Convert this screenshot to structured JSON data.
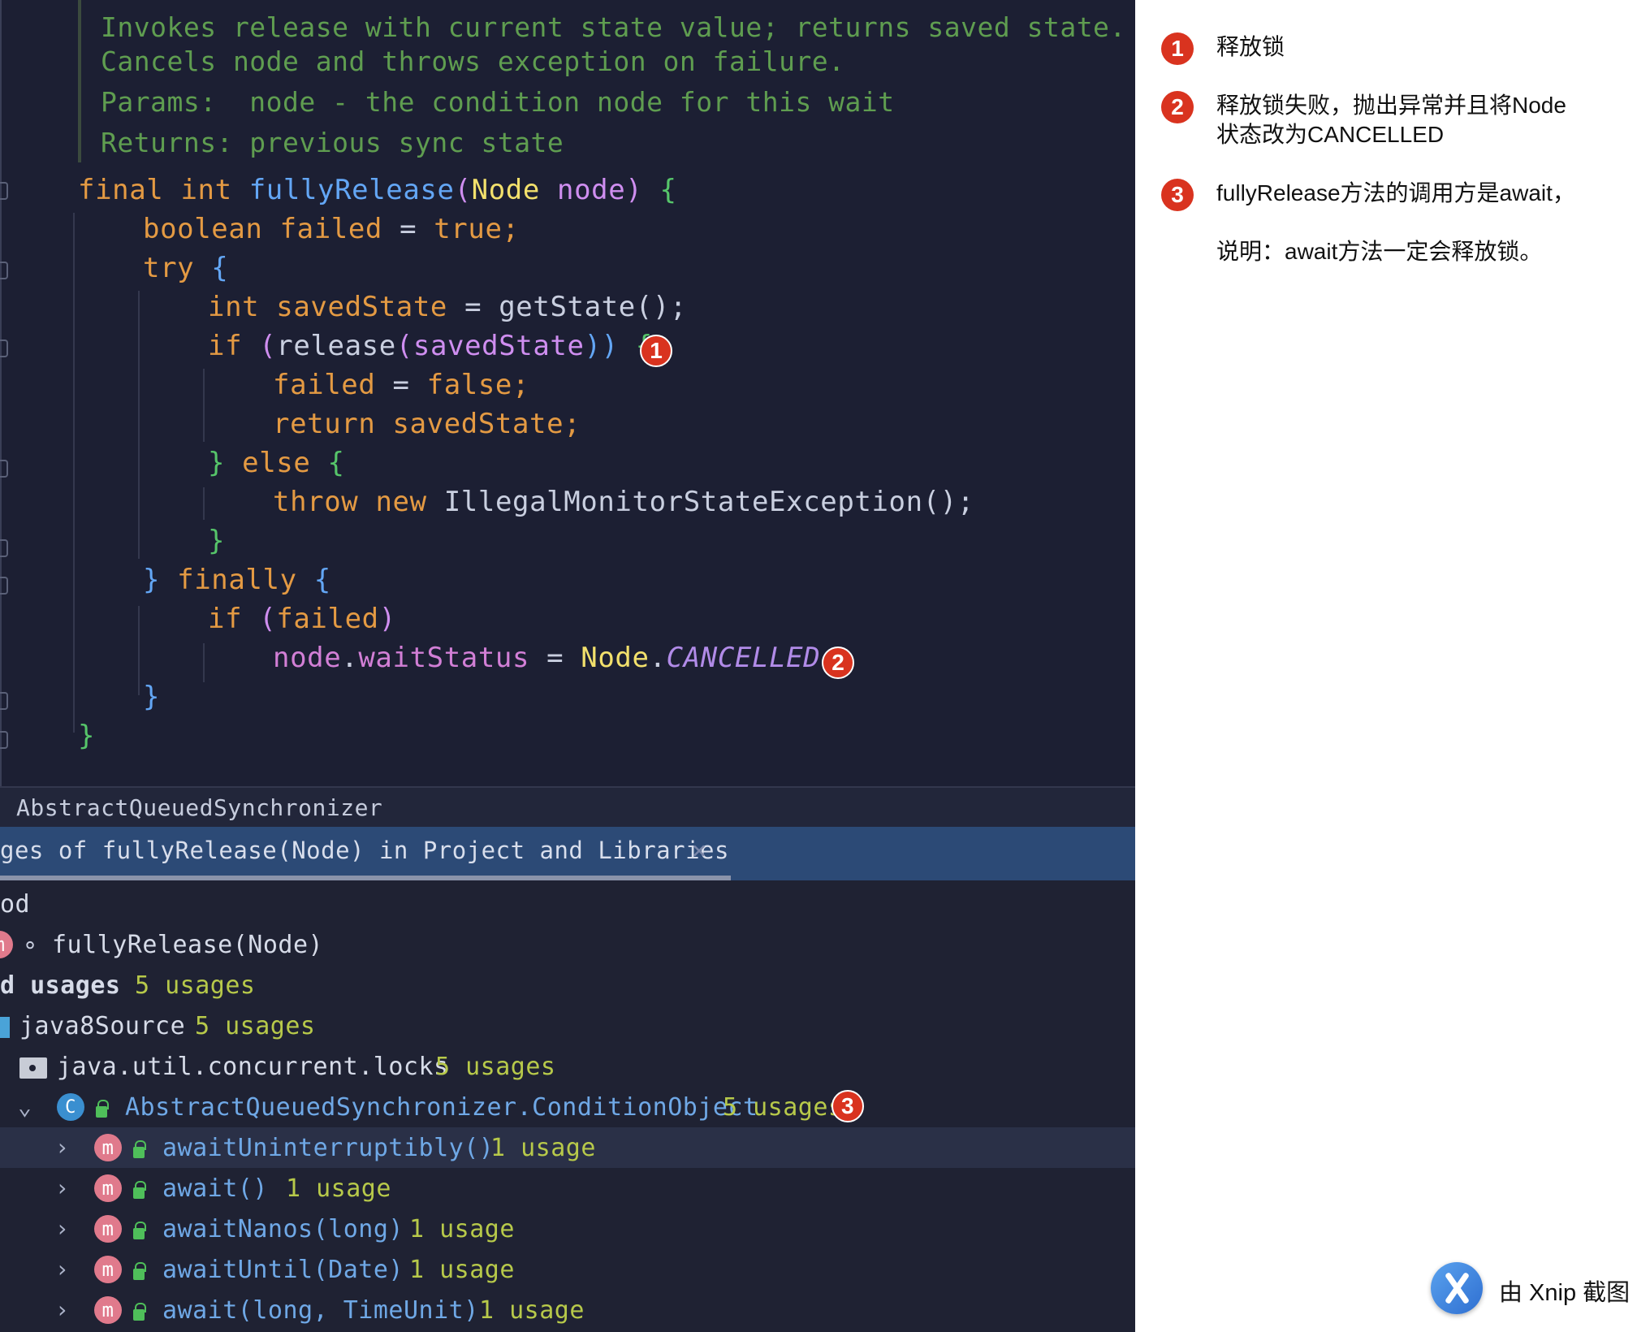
{
  "editor": {
    "doc": [
      "Invokes release with current state value; returns saved state.",
      "Cancels node and throws exception on failure.",
      "Params:  node - the condition node for this wait",
      "Returns: previous sync state"
    ],
    "code": {
      "l1": {
        "kw1": "final",
        "kw2": "int",
        "fn": "fullyRelease",
        "p1": "(",
        "ty": "Node",
        "vr": "node",
        "p2": ")",
        "b": "{"
      },
      "l2": {
        "kw": "boolean",
        "vr": "failed",
        "op": "=",
        "val": "true;"
      },
      "l3": {
        "kw": "try",
        "b": "{"
      },
      "l4": {
        "kw": "int",
        "vr": "savedState",
        "op": "=",
        "call": "getState();"
      },
      "l5": {
        "kw": "if",
        "p1": "(",
        "call": "release",
        "p2": "(",
        "vr": "savedState",
        "p3": "))",
        "b": "{"
      },
      "l6": {
        "vr": "failed",
        "op": "=",
        "val": "false;"
      },
      "l7": {
        "kw": "return",
        "vr": "savedState;"
      },
      "l8": {
        "b1": "}",
        "kw": "else",
        "b2": "{"
      },
      "l9": {
        "kw1": "throw",
        "kw2": "new",
        "call": "IllegalMonitorStateException();"
      },
      "l10": {
        "b": "}"
      },
      "l11": {
        "b1": "}",
        "kw": "finally",
        "b2": "{"
      },
      "l12": {
        "kw": "if",
        "p1": "(",
        "vr": "failed",
        "p2": ")"
      },
      "l13": {
        "vr": "node",
        "dot": ".",
        "fd": "waitStatus",
        "op": "=",
        "ty": "Node",
        "dot2": ".",
        "it": "CANCELLED",
        "semi": ";"
      },
      "l14": {
        "b": "}"
      },
      "l15": {
        "b": "}"
      }
    },
    "badges": {
      "b1": "1",
      "b2": "2"
    }
  },
  "breadcrumb": "AbstractQueuedSynchronizer",
  "tab": {
    "label": "ges of fullyRelease(Node) in Project and Libraries",
    "close": "×"
  },
  "tree": {
    "r1": "od",
    "r2": "fullyRelease(Node)",
    "r3": {
      "label": "d usages",
      "count": "5 usages"
    },
    "r4": {
      "label": "java8Source",
      "count": "5 usages"
    },
    "r5": {
      "label": "java.util.concurrent.locks",
      "count": "5 usages"
    },
    "r6": {
      "label": "AbstractQueuedSynchronizer.ConditionObject",
      "count": "5 usages",
      "badge": "3"
    },
    "methods": [
      {
        "label": "awaitUninterruptibly()",
        "count": "1 usage"
      },
      {
        "label": "await()",
        "count": "1 usage"
      },
      {
        "label": "awaitNanos(long)",
        "count": "1 usage"
      },
      {
        "label": "awaitUntil(Date)",
        "count": "1 usage"
      },
      {
        "label": "await(long, TimeUnit)",
        "count": "1 usage"
      }
    ]
  },
  "notes": {
    "n1": {
      "num": "1",
      "text": "释放锁"
    },
    "n2": {
      "num": "2",
      "text1": "释放锁失败，抛出异常并且将Node",
      "text2": "状态改为CANCELLED"
    },
    "n3": {
      "num": "3",
      "text1": "fullyRelease方法的调用方是await，",
      "text2": "说明：await方法一定会释放锁。"
    }
  },
  "watermark": "由 Xnip 截图"
}
